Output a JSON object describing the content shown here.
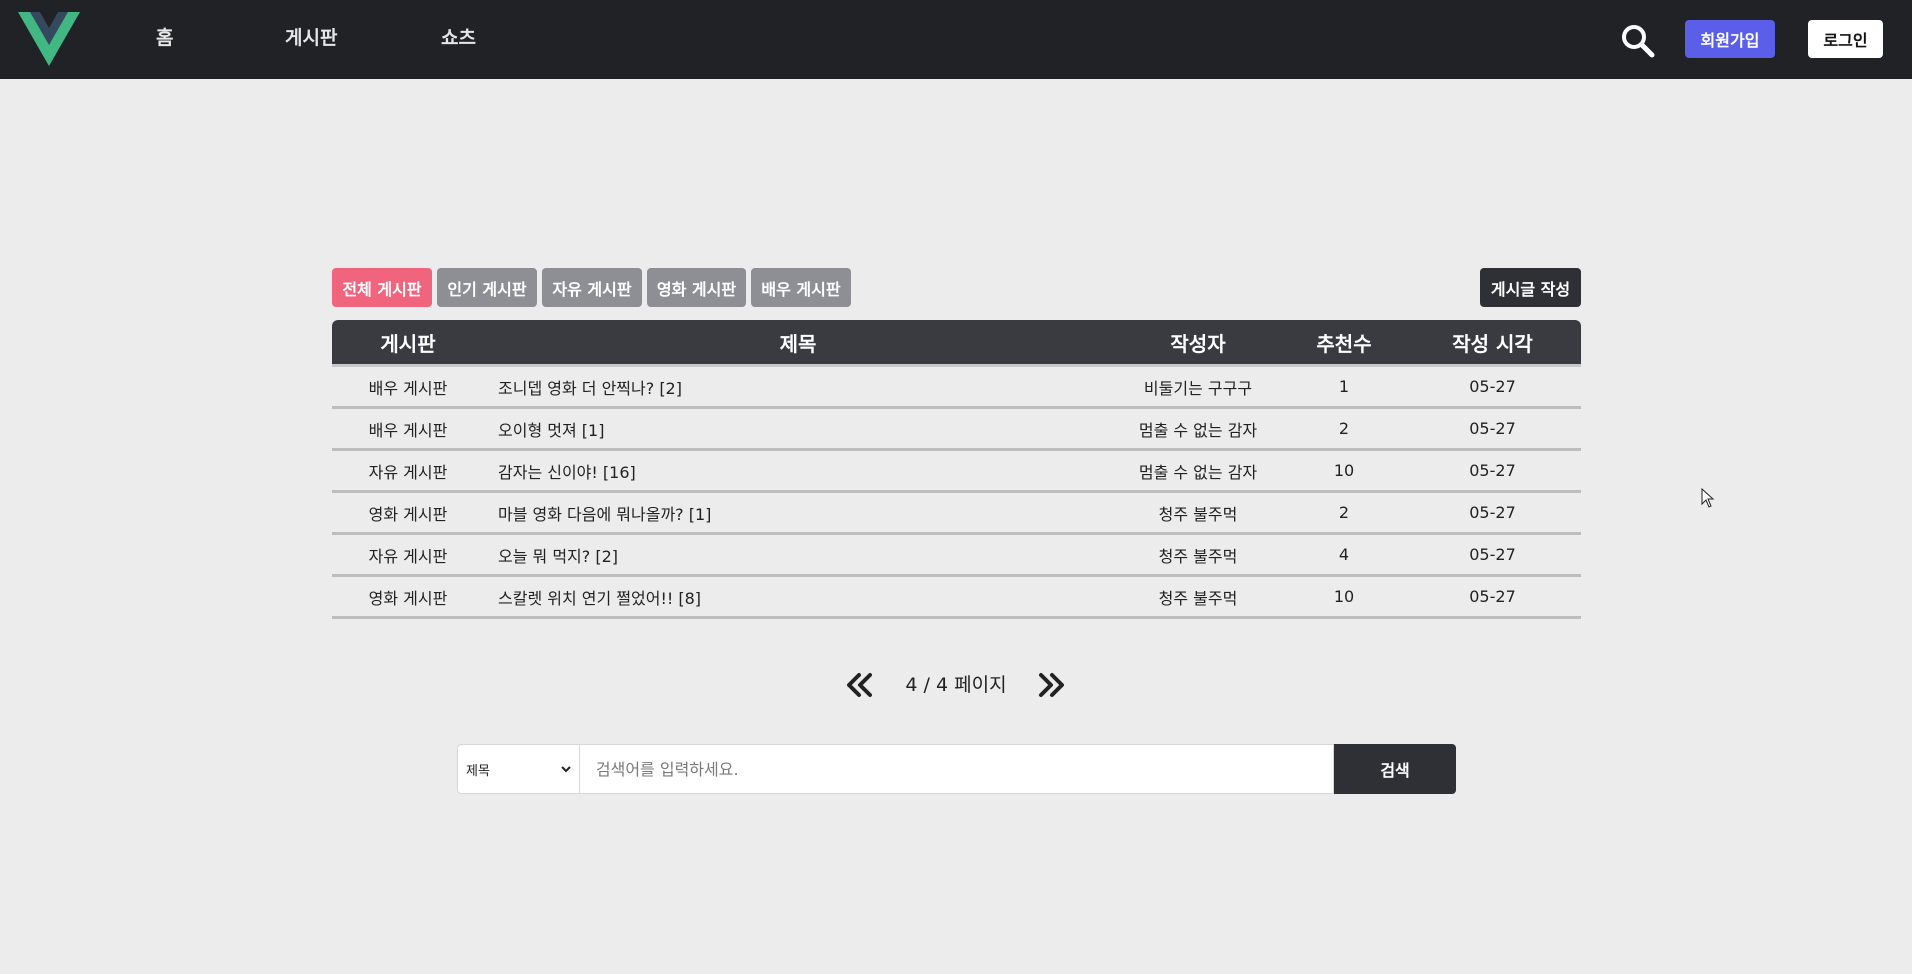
{
  "nav": {
    "links": [
      "홈",
      "게시판",
      "쇼츠"
    ],
    "signup_label": "회원가입",
    "login_label": "로그인"
  },
  "tabs": [
    {
      "label": "전체 게시판",
      "active": true
    },
    {
      "label": "인기 게시판",
      "active": false
    },
    {
      "label": "자유 게시판",
      "active": false
    },
    {
      "label": "영화 게시판",
      "active": false
    },
    {
      "label": "배우 게시판",
      "active": false
    }
  ],
  "write_label": "게시글 작성",
  "table": {
    "headers": {
      "board": "게시판",
      "title": "제목",
      "author": "작성자",
      "recommend": "추천수",
      "time": "작성 시각"
    },
    "rows": [
      {
        "board": "배우 게시판",
        "title": "조니뎁 영화 더 안찍나? [2]",
        "author": "비둘기는 구구구",
        "recommend": "1",
        "time": "05-27"
      },
      {
        "board": "배우 게시판",
        "title": "오이형 멋져 [1]",
        "author": "멈출 수 없는 감자",
        "recommend": "2",
        "time": "05-27"
      },
      {
        "board": "자유 게시판",
        "title": "감자는 신이야! [16]",
        "author": "멈출 수 없는 감자",
        "recommend": "10",
        "time": "05-27"
      },
      {
        "board": "영화 게시판",
        "title": "마블 영화 다음에 뭐나올까? [1]",
        "author": "청주 불주먹",
        "recommend": "2",
        "time": "05-27"
      },
      {
        "board": "자유 게시판",
        "title": "오늘 뭐 먹지? [2]",
        "author": "청주 불주먹",
        "recommend": "4",
        "time": "05-27"
      },
      {
        "board": "영화 게시판",
        "title": "스칼렛 위치 연기 쩔었어!! [8]",
        "author": "청주 불주먹",
        "recommend": "10",
        "time": "05-27"
      }
    ]
  },
  "pagination": {
    "text": "4 / 4 페이지"
  },
  "search": {
    "select_value": "제목",
    "placeholder": "검색어를 입력하세요.",
    "submit_label": "검색"
  },
  "colors": {
    "topbar": "#212226",
    "active_tab": "#f0647e",
    "inactive_tab": "#8e8f94",
    "signup": "#5a5ee8",
    "dark_button": "#2e3035"
  }
}
